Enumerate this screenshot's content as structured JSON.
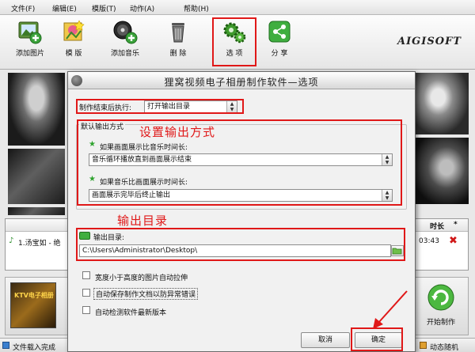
{
  "menubar": {
    "items": [
      "文件(F)",
      "编辑(E)",
      "模版(T)",
      "动作(A)",
      "帮助(H)"
    ]
  },
  "toolbar": {
    "items": [
      {
        "label": "添加图片",
        "icon": "add-image-icon"
      },
      {
        "label": "模 版",
        "icon": "template-icon"
      },
      {
        "label": "添加音乐",
        "icon": "add-music-icon"
      },
      {
        "label": "删 除",
        "icon": "trash-icon"
      },
      {
        "label": "选 项",
        "icon": "gears-icon"
      },
      {
        "label": "分 享",
        "icon": "share-icon"
      }
    ],
    "logo": "AIGISOFT"
  },
  "background": {
    "music_header_time": "时长",
    "music_header_star": "*",
    "music_item": "1.汤宝如 - 绝",
    "music_item_time": "03:43",
    "ktv_text": "KTV电子相册",
    "start_button": "开始制作",
    "status_left": "文件载入完成",
    "status_right": "动态随机"
  },
  "dialog": {
    "title": "狸窝视频电子相册制作软件—选项",
    "after_finish_label": "制作结束后执行:",
    "after_finish_value": "打开输出目录",
    "output_mode_group": "默认输出方式",
    "picture_longer_label": "如果画面展示比音乐时间长:",
    "picture_longer_value": "音乐循环播放直到画面展示结束",
    "music_longer_label": "如果音乐比画面展示时间长:",
    "music_longer_value": "画面展示完毕后终止输出",
    "output_dir_label": "输出目录:",
    "output_dir_value": "C:\\Users\\Administrator\\Desktop\\",
    "checkboxes": [
      "宽度小于高度的图片自动拉伸",
      "自动保存制作文档以防异常错误",
      "自动检测软件最新版本"
    ],
    "cancel_button": "取消",
    "ok_button": "确定"
  },
  "annotations": {
    "set_output_mode": "设置输出方式",
    "output_directory": "输出目录"
  },
  "colors": {
    "annotation_red": "#e01818",
    "star_green": "#2ea32e"
  }
}
